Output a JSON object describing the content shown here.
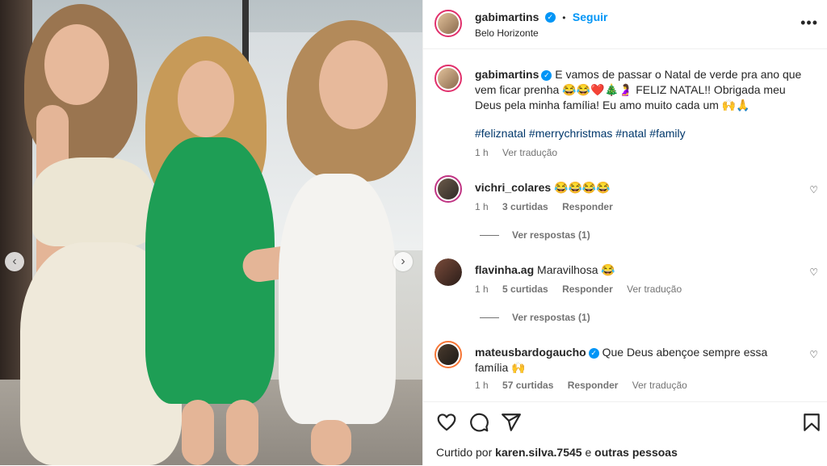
{
  "post": {
    "author": "gabimartins",
    "follow_label": "Seguir",
    "dot": "•",
    "location": "Belo Horizonte",
    "more_label": "•••"
  },
  "caption": {
    "author": "gabimartins",
    "text": "E vamos de passar o Natal de verde pra ano que vem ficar prenha 😂😂❤️🎄🤰 FELIZ NATAL!! Obrigada meu Deus pela minha família! Eu amo muito cada um 🙌🙏",
    "hashtags": "#feliznatal #merrychristmas #natal #family",
    "time": "1 h",
    "translate": "Ver tradução"
  },
  "comments": [
    {
      "user": "vichri_colares",
      "text": "😂😂😂😂",
      "time": "1 h",
      "likes": "3 curtidas",
      "reply": "Responder",
      "translate": "",
      "replies": "Ver respostas (1)"
    },
    {
      "user": "flavinha.ag",
      "text": "Maravilhosa 😂",
      "time": "1 h",
      "likes": "5 curtidas",
      "reply": "Responder",
      "translate": "Ver tradução",
      "replies": "Ver respostas (1)"
    },
    {
      "user": "mateusbardogaucho",
      "text": "Que Deus abençoe sempre essa família 🙌",
      "time": "1 h",
      "likes": "57 curtidas",
      "reply": "Responder",
      "translate": "Ver tradução",
      "replies": ""
    }
  ],
  "footer": {
    "liked_prefix": "Curtido por",
    "liked_user": "karen.silva.7545",
    "liked_and": "e",
    "liked_others": "outras pessoas"
  },
  "icons": {
    "like": "heart-icon",
    "comment": "comment-icon",
    "share": "share-icon",
    "save": "bookmark-icon"
  },
  "colors": {
    "link": "#0095f6",
    "hashtag": "#00376b",
    "muted": "#737373",
    "story_ring": "#e1306c"
  }
}
